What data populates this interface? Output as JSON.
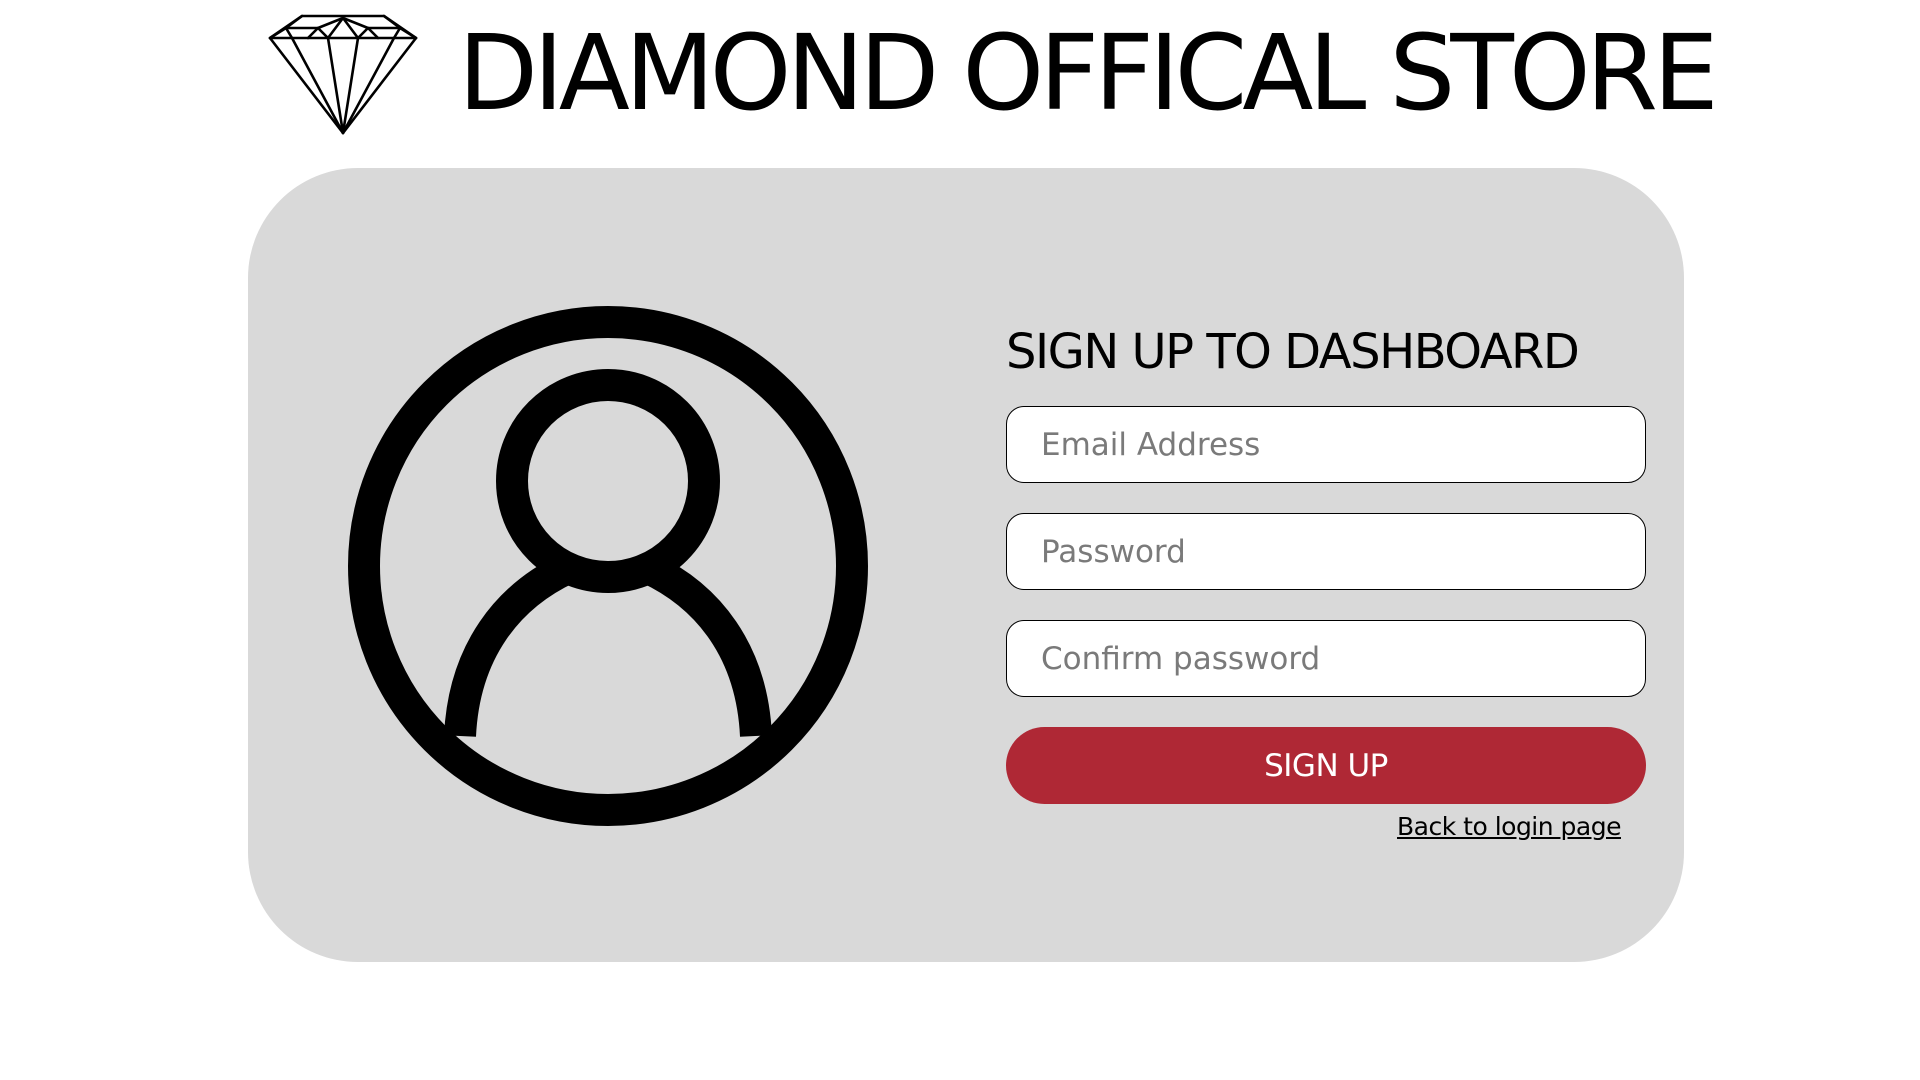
{
  "header": {
    "logo_icon": "diamond-icon",
    "title": "DIAMOND OFFICAL STORE"
  },
  "card": {
    "avatar_icon": "user-avatar-icon",
    "form": {
      "title": "SIGN UP TO DASHBOARD",
      "email": {
        "placeholder": "Email Address",
        "value": ""
      },
      "password": {
        "placeholder": "Password",
        "value": ""
      },
      "confirm_password": {
        "placeholder": "Confirm password",
        "value": ""
      },
      "submit_label": "SIGN UP",
      "back_link_label": "Back to login page"
    }
  },
  "colors": {
    "card_background": "#d9d9d9",
    "button_background": "#af2835",
    "button_text": "#ffffff",
    "page_background": "#ffffff"
  }
}
